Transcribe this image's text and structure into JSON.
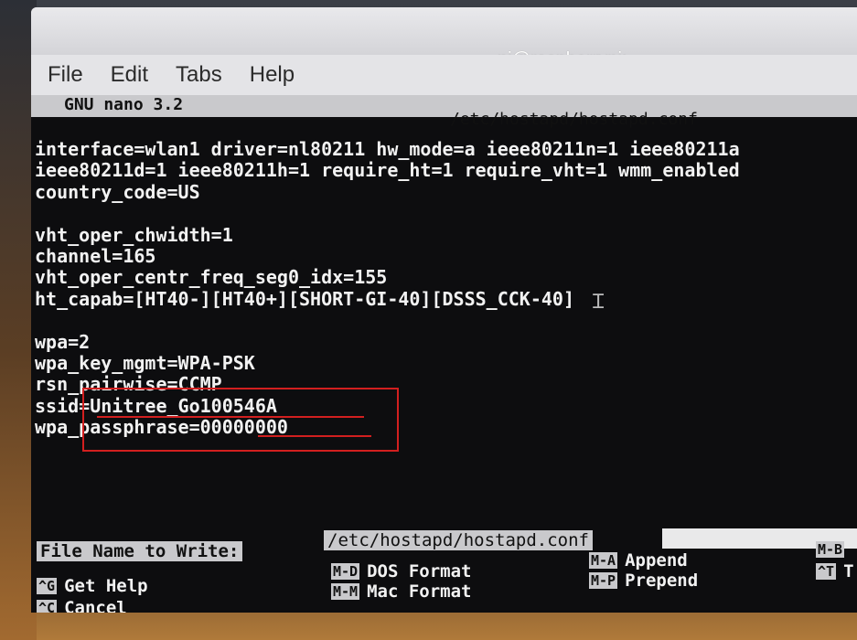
{
  "window": {
    "title": "pi@raspberrypi: ~"
  },
  "menu": [
    "File",
    "Edit",
    "Tabs",
    "Help"
  ],
  "nano": {
    "version": "GNU nano 3.2",
    "filename": "/etc/hostapd/hostapd.conf"
  },
  "file_lines": [
    "interface=wlan1 driver=nl80211 hw_mode=a ieee80211n=1 ieee80211a",
    "ieee80211d=1 ieee80211h=1 require_ht=1 require_vht=1 wmm_enabled",
    "country_code=US",
    "",
    "vht_oper_chwidth=1",
    "channel=165",
    "vht_oper_centr_freq_seg0_idx=155",
    "ht_capab=[HT40-][HT40+][SHORT-GI-40][DSSS_CCK-40]",
    "",
    "wpa=2",
    "wpa_key_mgmt=WPA-PSK",
    "rsn_pairwise=CCMP",
    "ssid=Unitree_Go100546A",
    "wpa_passphrase=00000000"
  ],
  "prompt": {
    "label": "File Name to Write:",
    "value": "/etc/hostapd/hostapd.conf"
  },
  "shortcuts": [
    {
      "key": "^G",
      "label": "Get Help"
    },
    {
      "key": "^C",
      "label": "Cancel"
    },
    {
      "key": "M-D",
      "label": "DOS Format"
    },
    {
      "key": "M-M",
      "label": "Mac Format"
    },
    {
      "key": "M-A",
      "label": "Append"
    },
    {
      "key": "M-P",
      "label": "Prepend"
    },
    {
      "key": "M-B",
      "label": ""
    },
    {
      "key": "^T",
      "label": "T"
    }
  ],
  "colors": {
    "highlight_box": "#d21f1f",
    "terminal_bg": "#0d0d0f",
    "nano_bar": "#c9c9cc"
  }
}
